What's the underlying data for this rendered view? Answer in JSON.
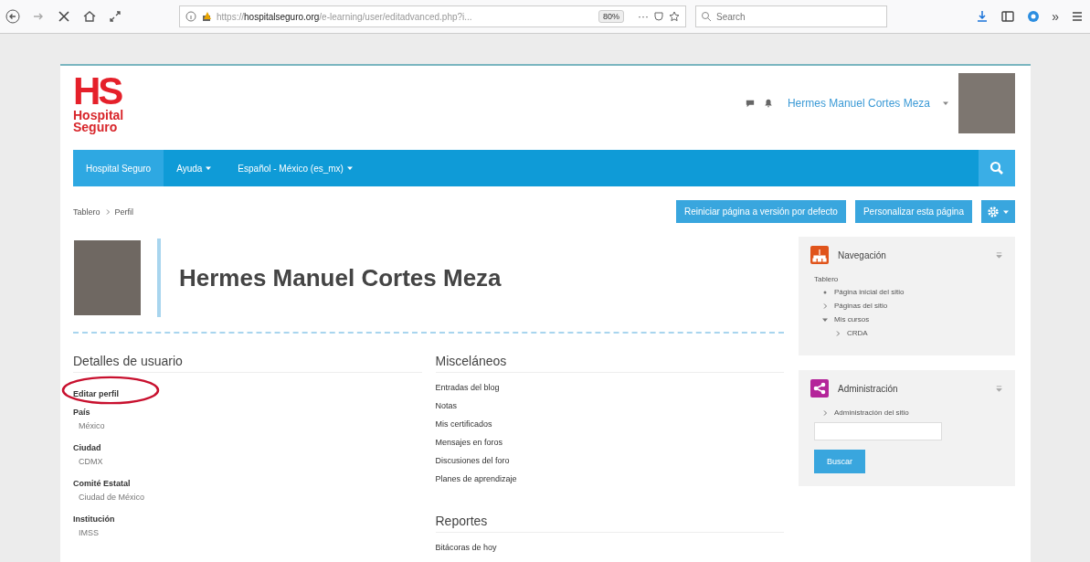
{
  "browser": {
    "url_prefix": "https://",
    "url_domain": "hospitalseguro.org",
    "url_path": "/e-learning/user/editadvanced.php?i...",
    "zoom": "80%",
    "more": "···",
    "search_placeholder": "Search",
    "overflow": "»"
  },
  "header": {
    "logo_mark": "HS",
    "logo_line1": "Hospital",
    "logo_line2": "Seguro",
    "user_name": "Hermes Manuel Cortes Meza"
  },
  "navbar": {
    "items": [
      {
        "label": "Hospital Seguro",
        "selected": true,
        "dropdown": false
      },
      {
        "label": "Ayuda",
        "selected": false,
        "dropdown": true
      },
      {
        "label": "Español - México (es_mx)",
        "selected": false,
        "dropdown": true
      }
    ]
  },
  "breadcrumb": [
    "Tablero",
    "Perfil"
  ],
  "actions": [
    "Reiniciar página a versión por defecto",
    "Personalizar esta página"
  ],
  "profile": {
    "name": "Hermes Manuel Cortes Meza"
  },
  "details": {
    "title": "Detalles de usuario",
    "edit_link": {
      "label": "Editar perfil",
      "circled": true
    },
    "fields": [
      {
        "label": "País",
        "value": "México"
      },
      {
        "label": "Ciudad",
        "value": "CDMX"
      },
      {
        "label": "Comité Estatal",
        "value": "Ciudad de México"
      },
      {
        "label": "Institución",
        "value": "IMSS"
      }
    ]
  },
  "misc": {
    "title": "Misceláneos",
    "links": [
      "Entradas del blog",
      "Notas",
      "Mis certificados",
      "Mensajes en foros",
      "Discusiones del foro",
      "Planes de aprendizaje"
    ]
  },
  "reports": {
    "title": "Reportes",
    "links": [
      "Bitácoras de hoy"
    ]
  },
  "navigation": {
    "title": "Navegación",
    "root": "Tablero",
    "items": [
      {
        "label": "Página inicial del sitio",
        "kind": "leaf"
      },
      {
        "label": "Páginas del sitio",
        "kind": "branch",
        "expanded": false
      },
      {
        "label": "Mis cursos",
        "kind": "branch",
        "expanded": true,
        "children": [
          {
            "label": "CRDA",
            "kind": "branch",
            "expanded": false
          }
        ]
      }
    ]
  },
  "administration": {
    "title": "Administración",
    "items": [
      {
        "label": "Administración del sitio",
        "kind": "branch",
        "expanded": false
      }
    ],
    "search_button": "Buscar"
  }
}
